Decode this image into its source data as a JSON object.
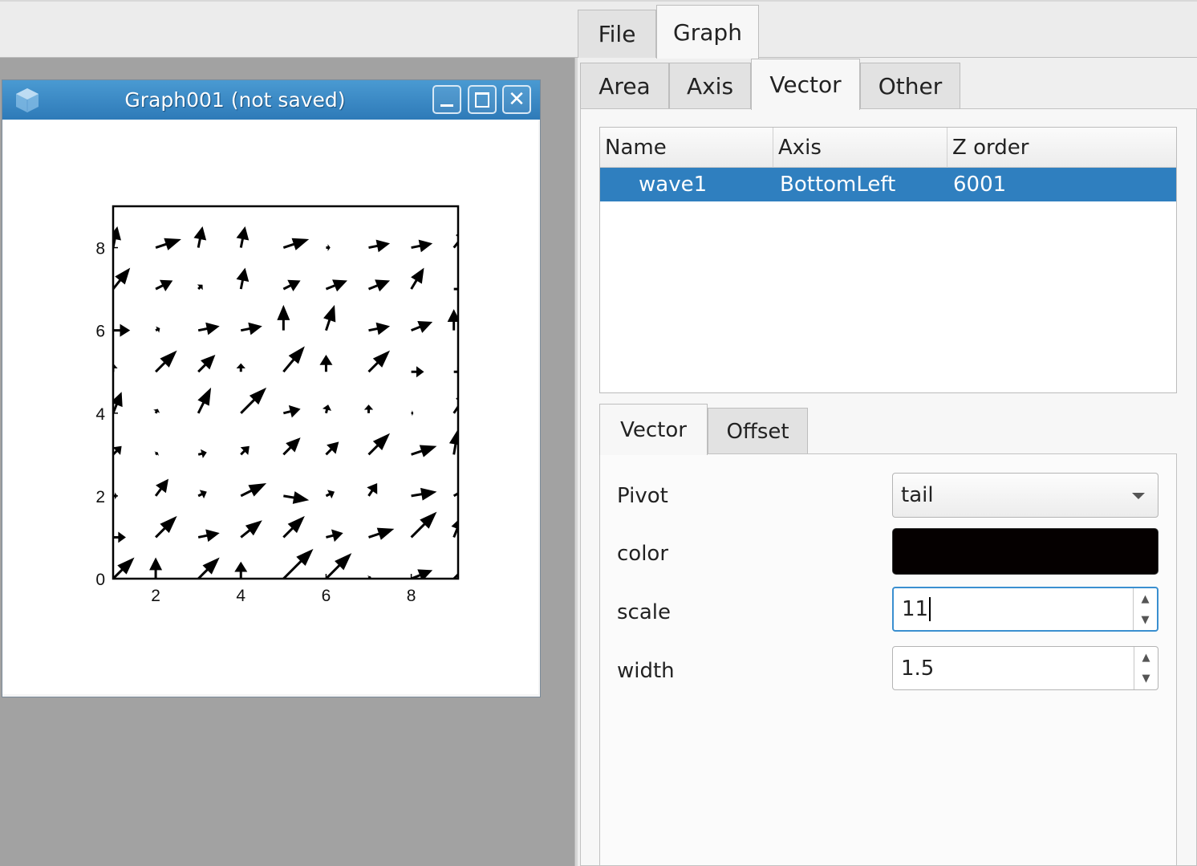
{
  "main_tabs": [
    {
      "label": "File"
    },
    {
      "label": "Graph"
    }
  ],
  "graph_window": {
    "title": "Graph001 (not saved)"
  },
  "graph_tabs": [
    {
      "label": "Area"
    },
    {
      "label": "Axis"
    },
    {
      "label": "Vector"
    },
    {
      "label": "Other"
    }
  ],
  "vector_table": {
    "columns": [
      "Name",
      "Axis",
      "Z order"
    ],
    "rows": [
      {
        "name": "wave1",
        "axis": "BottomLeft",
        "z_order": "6001"
      }
    ]
  },
  "vector_tabs": [
    {
      "label": "Vector"
    },
    {
      "label": "Offset"
    }
  ],
  "vector_props": {
    "pivot_label": "Pivot",
    "pivot_value": "tail",
    "color_label": "color",
    "color_value": "#050000",
    "scale_label": "scale",
    "scale_value": "11",
    "width_label": "width",
    "width_value": "1.5"
  },
  "chart_data": {
    "type": "quiver",
    "xlim": [
      1,
      9.1
    ],
    "ylim": [
      0,
      9
    ],
    "x_ticks": [
      2,
      4,
      6,
      8
    ],
    "y_ticks": [
      0,
      2,
      4,
      6,
      8
    ],
    "grid": false,
    "x": [
      1,
      2,
      3,
      4,
      5,
      6,
      7,
      8,
      9
    ],
    "y": [
      0,
      1,
      2,
      3,
      4,
      5,
      6,
      7,
      8,
      9
    ],
    "vectors_dx_dy_by_row": [
      [
        [
          0.5,
          0.5
        ],
        [
          0,
          0.5
        ],
        [
          0.5,
          0.5
        ],
        [
          0,
          0.4
        ],
        [
          0.7,
          0.7
        ],
        [
          0.6,
          0.6
        ],
        [
          0.05,
          0.05
        ],
        [
          0.5,
          0.2
        ],
        [
          0.7,
          0.7
        ]
      ],
      [
        [
          0.3,
          0
        ],
        [
          0.5,
          0.5
        ],
        [
          0.5,
          0.1
        ],
        [
          0.5,
          0.4
        ],
        [
          0.5,
          0.5
        ],
        [
          0.4,
          0.1
        ],
        [
          0.6,
          0.2
        ],
        [
          0.6,
          0.6
        ],
        [
          0.2,
          0.5
        ]
      ],
      [
        [
          0.1,
          0
        ],
        [
          0.3,
          0.4
        ],
        [
          0.2,
          0.1
        ],
        [
          0.6,
          0.3
        ],
        [
          0.6,
          -0.1
        ],
        [
          0.2,
          0.1
        ],
        [
          0.2,
          0.3
        ],
        [
          0.6,
          0.1
        ],
        [
          0.5,
          0.3
        ]
      ],
      [
        [
          0.2,
          0.2
        ],
        [
          0.05,
          0.05
        ],
        [
          0.2,
          0.05
        ],
        [
          0.2,
          0.2
        ],
        [
          0.4,
          0.4
        ],
        [
          0.3,
          0.3
        ],
        [
          0.5,
          0.5
        ],
        [
          0.6,
          0.2
        ],
        [
          0.1,
          0.6
        ]
      ],
      [
        [
          0.2,
          0.5
        ],
        [
          0.05,
          0.1
        ],
        [
          0.3,
          0.6
        ],
        [
          0.6,
          0.6
        ],
        [
          0.4,
          0.1
        ],
        [
          0.05,
          0.2
        ],
        [
          0,
          0.2
        ],
        [
          0.05,
          0
        ],
        [
          0.4,
          0.6
        ]
      ],
      [
        [
          0,
          0.2
        ],
        [
          0.5,
          0.5
        ],
        [
          0.4,
          0.4
        ],
        [
          0,
          0.2
        ],
        [
          0.5,
          0.6
        ],
        [
          0,
          0.4
        ],
        [
          0.5,
          0.5
        ],
        [
          0.3,
          0
        ],
        [
          0.2,
          0
        ]
      ],
      [
        [
          0.4,
          0
        ],
        [
          0.1,
          0.05
        ],
        [
          0.5,
          0.1
        ],
        [
          0.5,
          0.1
        ],
        [
          0,
          0.6
        ],
        [
          0.2,
          0.6
        ],
        [
          0.5,
          0.1
        ],
        [
          0.5,
          0.2
        ],
        [
          0,
          0.5
        ]
      ],
      [
        [
          0.4,
          0.5
        ],
        [
          0.4,
          0.2
        ],
        [
          0.1,
          0.1
        ],
        [
          0.1,
          0.5
        ],
        [
          0.4,
          0.2
        ],
        [
          0.5,
          0.2
        ],
        [
          0.5,
          0.2
        ],
        [
          0.3,
          0.5
        ],
        [
          0.5,
          0
        ]
      ],
      [
        [
          0.1,
          0.5
        ],
        [
          0.6,
          0.2
        ],
        [
          0.1,
          0.5
        ],
        [
          0.1,
          0.5
        ],
        [
          0.6,
          0.2
        ],
        [
          0.1,
          0
        ],
        [
          0.5,
          0.1
        ],
        [
          0.5,
          0.1
        ],
        [
          0.4,
          0.5
        ]
      ],
      [
        [
          0,
          0.1
        ],
        [
          0,
          0.1
        ],
        [
          0,
          0.1
        ],
        [
          0,
          0.1
        ],
        [
          0,
          0.1
        ],
        [
          0,
          0.1
        ],
        [
          0,
          0.1
        ],
        [
          0,
          0.1
        ],
        [
          0,
          0.1
        ]
      ]
    ]
  }
}
